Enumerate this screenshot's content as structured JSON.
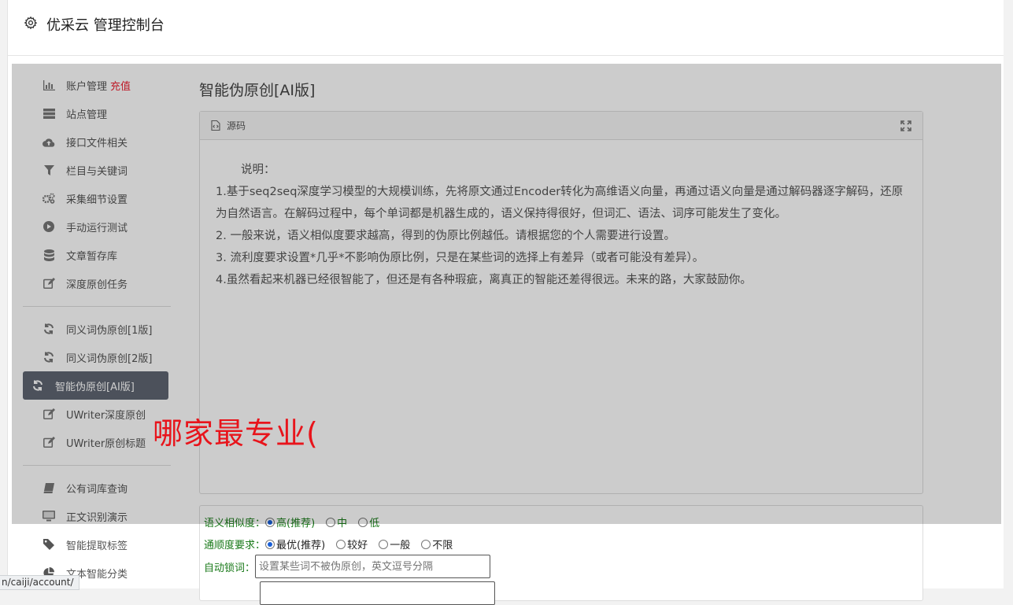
{
  "header": {
    "title": "优采云 管理控制台",
    "icon": "gear-icon"
  },
  "sidebar": {
    "group1": [
      {
        "label": "账户管理",
        "extra": "充值",
        "icon": "bar-chart-icon"
      },
      {
        "label": "站点管理",
        "icon": "server-icon"
      },
      {
        "label": "接口文件相关",
        "icon": "cloud-upload-icon"
      },
      {
        "label": "栏目与关键词",
        "icon": "filter-icon"
      },
      {
        "label": "采集细节设置",
        "icon": "gears-icon"
      },
      {
        "label": "手动运行测试",
        "icon": "play-circle-icon"
      },
      {
        "label": "文章暂存库",
        "icon": "database-icon"
      },
      {
        "label": "深度原创任务",
        "icon": "edit-icon"
      }
    ],
    "group2": [
      {
        "label": "同义词伪原创[1版]",
        "icon": "refresh-icon"
      },
      {
        "label": "同义词伪原创[2版]",
        "icon": "refresh-icon"
      },
      {
        "label": "智能伪原创[AI版]",
        "icon": "refresh-icon"
      },
      {
        "label": "UWriter深度原创",
        "icon": "edit-icon"
      },
      {
        "label": "UWriter原创标题",
        "icon": "edit-icon"
      }
    ],
    "group3": [
      {
        "label": "公有词库查询",
        "icon": "book-icon"
      },
      {
        "label": "正文识别演示",
        "icon": "monitor-icon"
      },
      {
        "label": "智能提取标签",
        "icon": "tag-icon"
      },
      {
        "label": "文本智能分类",
        "icon": "pie-chart-icon"
      }
    ]
  },
  "main": {
    "title": "智能伪原创[AI版]",
    "panel_title": "源码",
    "editor": {
      "intro": "说明：",
      "p1": "1.基于seq2seq深度学习模型的大规模训练，先将原文通过Encoder转化为高维语义向量，再通过语义向量是通过解码器逐字解码，还原为自然语言。在解码过程中，每个单词都是机器生成的，语义保持得很好，但词汇、语法、词序可能发生了变化。",
      "p2": "2. 一般来说，语义相似度要求越高，得到的伪原比例越低。请根据您的个人需要进行设置。",
      "p3": "3. 流利度要求设置*几乎*不影响伪原比例，只是在某些词的选择上有差异（或者可能没有差异）。",
      "p4": "4.虽然看起来机器已经很智能了，但还是有各种瑕疵，离真正的智能还差得很远。未来的路，大家鼓励你。"
    },
    "form": {
      "similarity_label": "语义相似度：",
      "similarity_options": [
        "高(推荐)",
        "中",
        "低"
      ],
      "fluency_label": "通顺度要求：",
      "fluency_options": [
        "最优(推荐)",
        "较好",
        "一般",
        "不限"
      ],
      "lock_label": "自动锁词：",
      "lock_placeholder": "设置某些词不被伪原创，英文逗号分隔"
    }
  },
  "watermark": "哪家最专业(",
  "status_url": "n/caiji/account/"
}
